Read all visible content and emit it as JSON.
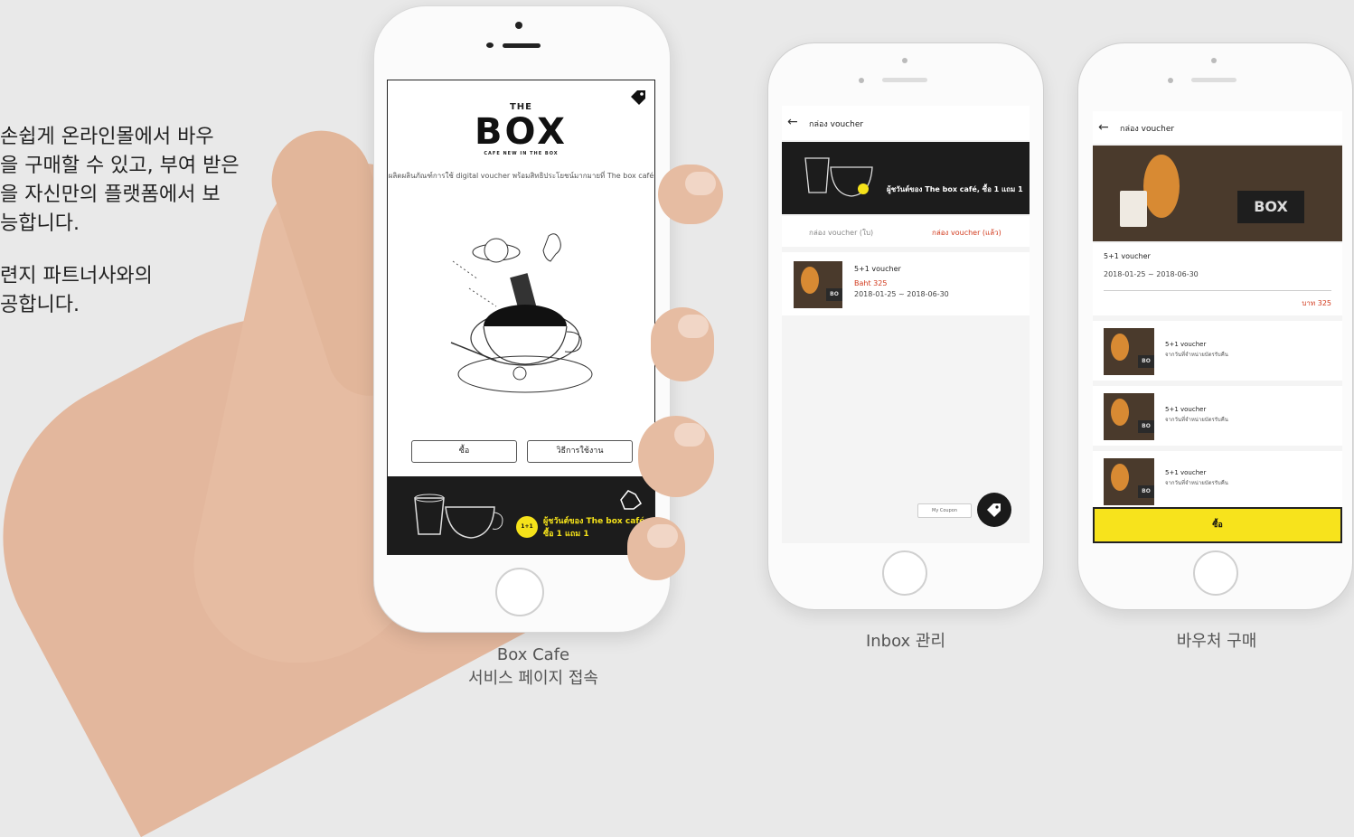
{
  "intro": {
    "lines1": [
      "손쉽게 온라인몰에서 바우",
      "을 구매할 수 있고, 부여 받은",
      "을 자신만의 플랫폼에서 보",
      "능합니다."
    ],
    "lines2": [
      "련지 파트너사와의",
      "공합니다."
    ]
  },
  "phone_main": {
    "brand_the": "THE",
    "brand_box": "BOX",
    "brand_tagline": "CAFE NEW IN THE BOX",
    "description": "ผลิตผลินภัณฑ์การใช้ digital voucher พร้อมสิทธิประโยชน์มากมายที่ The box café",
    "buy_button": "ซื้อ",
    "howto_button": "วิธีการใช้งาน",
    "banner_badge": "1+1",
    "banner_line1": "ผู้ชวันต์ของ The box café",
    "banner_line2": "ซื้อ 1 แถม 1",
    "caption_line1": "Box Cafe",
    "caption_line2": "서비스 페이지 접속"
  },
  "phone_inbox": {
    "header_title": "กล่อง voucher",
    "banner_text": "ผู้ชวันต์ของ The box café, ซื้อ 1 แถม 1",
    "tab_inbox": "กล่อง voucher (ใบ)",
    "tab_used": "กล่อง voucher (แล้ว)",
    "item_title": "5+1 voucher",
    "item_price": "Baht 325",
    "item_dates": "2018-01-25 ~ 2018-06-30",
    "fab_label": "My Coupon",
    "caption": "Inbox 관리"
  },
  "phone_purchase": {
    "header_title": "กล่อง voucher",
    "product_title": "5+1 voucher",
    "product_dates": "2018-01-25 ~ 2018-06-30",
    "product_price": "บาท 325",
    "list": [
      {
        "title": "5+1 voucher",
        "sub": "จากวันที่จำหน่ายบัตรรับคืน"
      },
      {
        "title": "5+1 voucher",
        "sub": "จากวันที่จำหน่ายบัตรรับคืน"
      },
      {
        "title": "5+1 voucher",
        "sub": "จากวันที่จำหน่ายบัตรรับคืน"
      }
    ],
    "buy_label": "ซื้อ",
    "caption": "바우처 구매"
  },
  "colors": {
    "accent_yellow": "#f5e21a",
    "accent_red": "#d23b1e",
    "dark": "#1c1c1c"
  }
}
